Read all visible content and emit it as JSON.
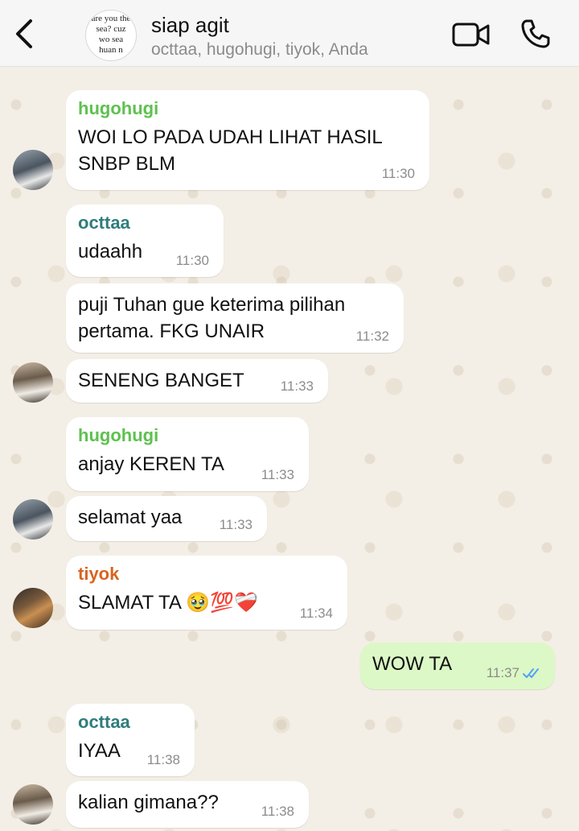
{
  "header": {
    "title": "siap agit",
    "members": "octtaa, hugohugi, tiyok, Anda",
    "avatar_text": [
      "are you the",
      "sea?   cuz",
      "wo      sea",
      "huan     n"
    ]
  },
  "colors": {
    "hugohugi": "#5ec14f",
    "octtaa": "#2f7d7b",
    "tiyok": "#d8651f",
    "outgoing": "#dcf8c6",
    "read_ticks": "#4fa3f7"
  },
  "messages": [
    {
      "sender": "hugohugi",
      "text": "WOI LO PADA UDAH LIHAT HASIL SNBP BLM",
      "time": "11:30"
    },
    {
      "sender": "octtaa",
      "text": "udaahh",
      "time": "11:30"
    },
    {
      "sender": "",
      "text": "puji Tuhan gue keterima pilihan pertama. FKG UNAIR",
      "time": "11:32"
    },
    {
      "sender": "",
      "text": "SENENG BANGET",
      "time": "11:33"
    },
    {
      "sender": "hugohugi",
      "text": "anjay KEREN TA",
      "time": "11:33"
    },
    {
      "sender": "",
      "text": "selamat yaa",
      "time": "11:33"
    },
    {
      "sender": "tiyok",
      "text": "SLAMAT TA 🥹💯❤️‍🩹",
      "time": "11:34"
    },
    {
      "sender": "",
      "text": "WOW TA",
      "time": "11:37",
      "outgoing": true,
      "status": "read"
    },
    {
      "sender": "octtaa",
      "text": "IYAA",
      "time": "11:38"
    },
    {
      "sender": "",
      "text": "kalian gimana??",
      "time": "11:38"
    }
  ],
  "icons": {
    "back": "chevron-left-icon",
    "video": "video-camera-icon",
    "call": "phone-icon",
    "read": "double-check-icon"
  }
}
